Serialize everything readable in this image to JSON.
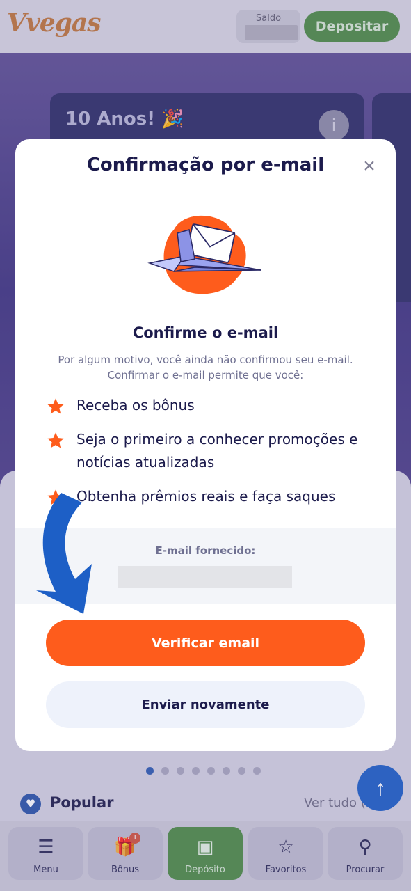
{
  "header": {
    "logo_text": "Vvegas",
    "balance_label": "Saldo",
    "deposit_button": "Depositar"
  },
  "promo": {
    "title": "10 Anos! 🎉",
    "info_icon": "i"
  },
  "carousel": {
    "dot_count": 8,
    "active_index": 0
  },
  "popular": {
    "title": "Popular",
    "see_all": "Ver tudo (..."
  },
  "bottom_nav": {
    "items": [
      {
        "label": "Menu",
        "icon": "hamburger-icon"
      },
      {
        "label": "Bônus",
        "icon": "gift-icon",
        "badge": "1"
      },
      {
        "label": "Depósito",
        "icon": "wallet-icon"
      },
      {
        "label": "Favoritos",
        "icon": "star-icon"
      },
      {
        "label": "Procurar",
        "icon": "search-icon"
      }
    ]
  },
  "modal": {
    "title": "Confirmação por e-mail",
    "close_icon": "close-icon",
    "illustration": "paper-plane-envelope",
    "subtitle": "Confirme o e-mail",
    "intro": "Por algum motivo, você ainda não confirmou seu e-mail. Confirmar o e-mail permite que você:",
    "benefits": [
      "Receba os bônus",
      "Seja o primeiro a conhecer promoções e notícias atualizadas",
      "Obtenha prêmios reais e faça saques"
    ],
    "email_label": "E-mail fornecido:",
    "verify_button": "Verificar email",
    "resend_button": "Enviar novamente"
  },
  "colors": {
    "accent_orange": "#fe5c1c",
    "brand_green": "#4d8c44",
    "title_navy": "#1c1b4c",
    "arrow_blue": "#1d5fc6"
  }
}
